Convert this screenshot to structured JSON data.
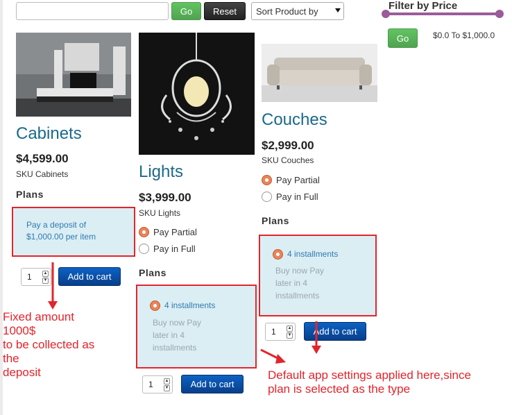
{
  "toolbar": {
    "search_value": "",
    "go_label": "Go",
    "reset_label": "Reset",
    "sort_selected": "Sort Product by"
  },
  "price_filter": {
    "title": "Filter by Price",
    "go_label": "Go",
    "range_text": "$0.0 To $1,000.0"
  },
  "products": [
    {
      "title": "Cabinets",
      "price": "$4,599.00",
      "sku": "SKU Cabinets",
      "plans_label": "Plans",
      "plan_text": "Pay a deposit of $1,000.00 per item",
      "qty": "1",
      "add_to_cart": "Add to cart"
    },
    {
      "title": "Lights",
      "price": "$3,999.00",
      "sku": "SKU Lights",
      "options": [
        "Pay Partial",
        "Pay in Full"
      ],
      "plans_label": "Plans",
      "installment_label": "4 installments",
      "installment_desc": "Buy now Pay later in 4 installments",
      "qty": "1",
      "add_to_cart": "Add to cart"
    },
    {
      "title": "Couches",
      "price": "$2,999.00",
      "sku": "SKU Couches",
      "options": [
        "Pay Partial",
        "Pay in Full"
      ],
      "plans_label": "Plans",
      "installment_label": "4 installments",
      "installment_desc": "Buy now Pay later in 4 installments",
      "qty": "1",
      "add_to_cart": "Add to cart"
    }
  ],
  "annotations": {
    "fixed_amount": [
      "Fixed amount",
      "1000$",
      "to be collected as",
      "the",
      "deposit"
    ],
    "default_settings": [
      "Default app settings applied here,since",
      "plan is selected as the type"
    ]
  },
  "colors": {
    "accent_red": "#e3242b",
    "title_blue": "#1a6a8a",
    "plan_bg": "#dbeef4",
    "slider": "#9b5b9b",
    "green": "#51a351",
    "cart_blue": "#083f8a"
  }
}
